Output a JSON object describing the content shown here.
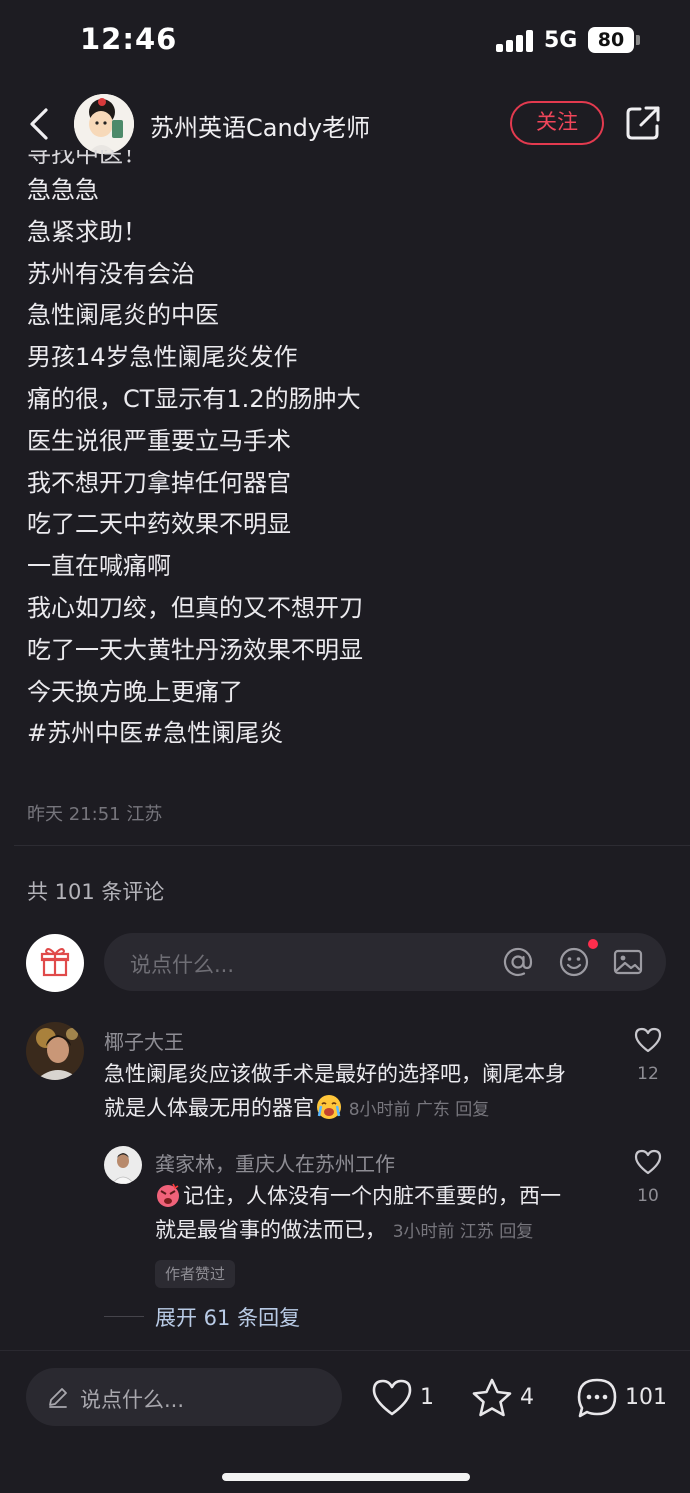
{
  "status_bar": {
    "time": "12:46",
    "network": "5G",
    "battery": "80"
  },
  "header": {
    "author_name": "苏州英语Candy老师",
    "follow_label": "关注"
  },
  "post": {
    "lines": [
      "寻找中医！",
      "急急急",
      "急紧求助！",
      "苏州有没有会治",
      "急性阑尾炎的中医",
      "男孩14岁急性阑尾炎发作",
      "痛的很，CT显示有1.2的肠肿大",
      "医生说很严重要立马手术",
      "我不想开刀拿掉任何器官",
      "吃了二天中药效果不明显",
      "一直在喊痛啊",
      "我心如刀绞，但真的又不想开刀",
      "吃了一天大黄牡丹汤效果不明显",
      "今天换方晚上更痛了",
      "#苏州中医#急性阑尾炎"
    ],
    "meta": "昨天 21:51 江苏"
  },
  "comments_header": {
    "count_text": "共 101 条评论",
    "input_placeholder": "说点什么..."
  },
  "comments": [
    {
      "name": "椰子大王",
      "text_line1": "急性阑尾炎应该做手术是最好的选择吧，阑尾本身",
      "text_line2": "就是人体最无用的器官",
      "meta": "8小时前 广东 回复",
      "likes": "12"
    },
    {
      "name": "龚家林，重庆人在苏州工作",
      "text_line1": "记住，人体没有一个内脏不重要的，西一",
      "text_line2": "就是最省事的做法而已，",
      "meta": "3小时前 江苏 回复",
      "likes": "10",
      "badge": "作者赞过"
    }
  ],
  "expand_replies": "展开 61 条回复",
  "bottom_bar": {
    "input_placeholder": "说点什么...",
    "likes": "1",
    "favorites": "4",
    "comments": "101"
  },
  "colors": {
    "background": "#1d1c22",
    "accent": "#f0465a",
    "link": "#b9cbe6"
  },
  "icons": [
    "back-icon",
    "share-icon",
    "gift-icon",
    "at-icon",
    "emoji-icon",
    "image-icon",
    "heart-icon",
    "star-icon",
    "comment-icon",
    "pen-icon",
    "crying-emoji-icon",
    "angry-emoji-icon"
  ]
}
